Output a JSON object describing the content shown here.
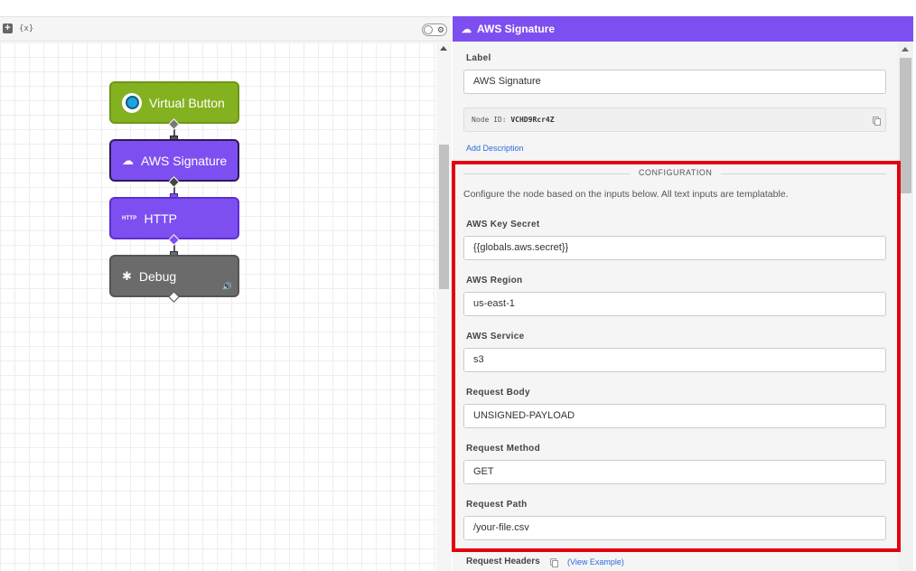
{
  "canvas": {
    "toolbar": {
      "add_icon": "+",
      "vars_icon": "{x}"
    },
    "nodes": [
      {
        "label": "Virtual Button",
        "color": "#84b120"
      },
      {
        "label": "AWS Signature",
        "color": "#7e4ff0"
      },
      {
        "label": "HTTP",
        "icon_text": "HTTP",
        "color": "#7e4ff0"
      },
      {
        "label": "Debug",
        "color": "#6b6b6b"
      }
    ]
  },
  "panel": {
    "title": "AWS Signature",
    "label_field": {
      "label": "Label",
      "value": "AWS Signature"
    },
    "node_id": {
      "prefix": "Node ID:",
      "value": "VCHD9Rcr4Z"
    },
    "add_description": "Add Description",
    "configuration": {
      "title": "CONFIGURATION",
      "description": "Configure the node based on the inputs below. All text inputs are templatable.",
      "fields": [
        {
          "label": "AWS Key Secret",
          "value": "{{globals.aws.secret}}"
        },
        {
          "label": "AWS Region",
          "value": "us-east-1"
        },
        {
          "label": "AWS Service",
          "value": "s3"
        },
        {
          "label": "Request Body",
          "value": "UNSIGNED-PAYLOAD"
        },
        {
          "label": "Request Method",
          "value": "GET"
        },
        {
          "label": "Request Path",
          "value": "/your-file.csv"
        }
      ]
    },
    "request_headers": {
      "label": "Request Headers",
      "example_link": "(View Example)"
    }
  },
  "colors": {
    "accent": "#7e4ff0",
    "highlight_box": "#e3000f",
    "link": "#2b6bd9"
  }
}
